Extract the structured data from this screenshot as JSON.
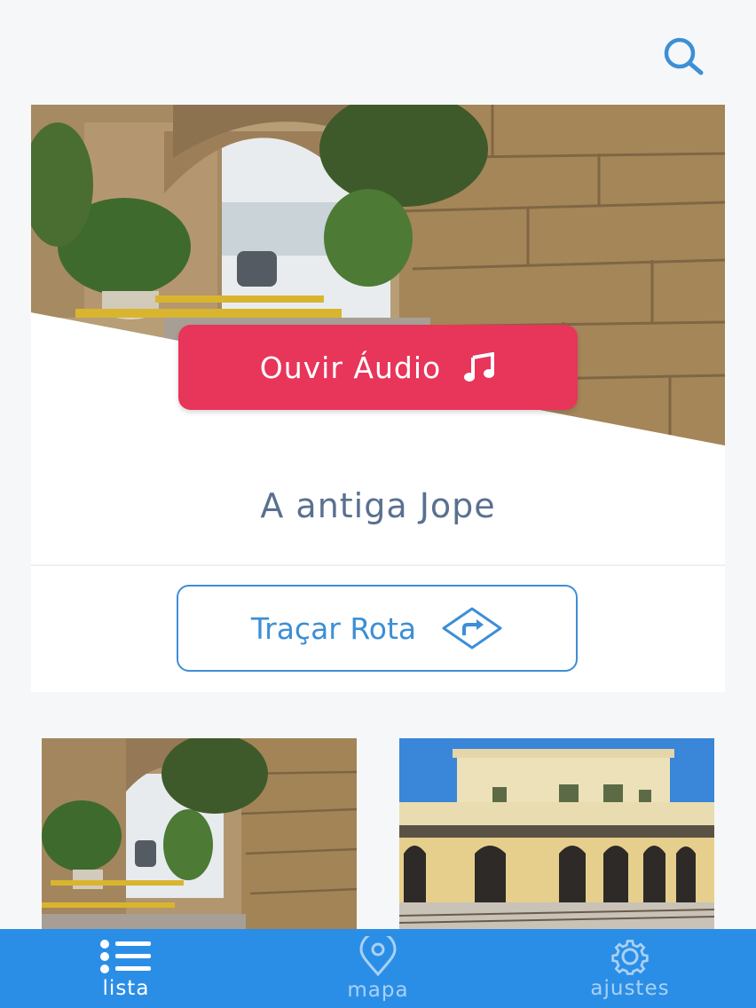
{
  "header": {
    "search_icon": "search-icon"
  },
  "featured": {
    "image": "alley-stone-arches",
    "audio_button_label": "Ouvir Áudio",
    "audio_icon": "music-note-icon",
    "title": "A antiga Jope",
    "route_button_label": "Traçar Rota",
    "route_icon": "directions-sign-icon"
  },
  "thumbnails": [
    {
      "image": "alley-stone-arches"
    },
    {
      "image": "old-train-station"
    }
  ],
  "bottom_nav": {
    "items": [
      {
        "label": "lista",
        "icon": "list-icon",
        "active": true
      },
      {
        "label": "mapa",
        "icon": "map-pin-icon",
        "active": false
      },
      {
        "label": "ajustes",
        "icon": "gear-icon",
        "active": false
      }
    ]
  },
  "colors": {
    "accent": "#2b8ee6",
    "audio_button": "#e8355a",
    "route_button": "#3d8fd6",
    "title_text": "#5a7090",
    "background": "#f6f7f9"
  }
}
